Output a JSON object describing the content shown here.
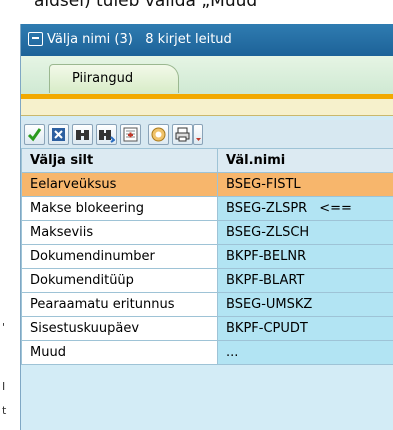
{
  "background_text": "aldsel) tuleb valida „Muud",
  "edge_fragments": [
    "'",
    "I",
    "t"
  ],
  "dialog": {
    "title": "Välja nimi (3)",
    "count_text": "8 kirjet leitud",
    "tab_label": "Piirangud"
  },
  "toolbar": {
    "buttons": [
      "checkmark-icon",
      "cancel-icon",
      "find-icon",
      "find-next-icon",
      "select-icon",
      "help-icon",
      "print-icon"
    ]
  },
  "table": {
    "headers": [
      "Välja silt",
      "Väl.nimi"
    ],
    "rows": [
      {
        "label": "Eelarveüksus",
        "field": "BSEG-FISTL",
        "marker": ""
      },
      {
        "label": "Makse blokeering",
        "field": "BSEG-ZLSPR",
        "marker": "<=="
      },
      {
        "label": "Makseviis",
        "field": "BSEG-ZLSCH",
        "marker": ""
      },
      {
        "label": "Dokumendinumber",
        "field": "BKPF-BELNR",
        "marker": ""
      },
      {
        "label": "Dokumenditüüp",
        "field": "BKPF-BLART",
        "marker": ""
      },
      {
        "label": "Pearaamatu eritunnus",
        "field": "BSEG-UMSKZ",
        "marker": ""
      },
      {
        "label": "Sisestuskuupäev",
        "field": "BKPF-CPUDT",
        "marker": ""
      },
      {
        "label": "Muud",
        "field": "...",
        "marker": ""
      }
    ],
    "selected_index": 0
  },
  "colors": {
    "title_bar": "#2f7cb1",
    "selected_row": "#f7b66c",
    "field_column": "#b2e4f3",
    "accent_bar": "#f2a900"
  }
}
